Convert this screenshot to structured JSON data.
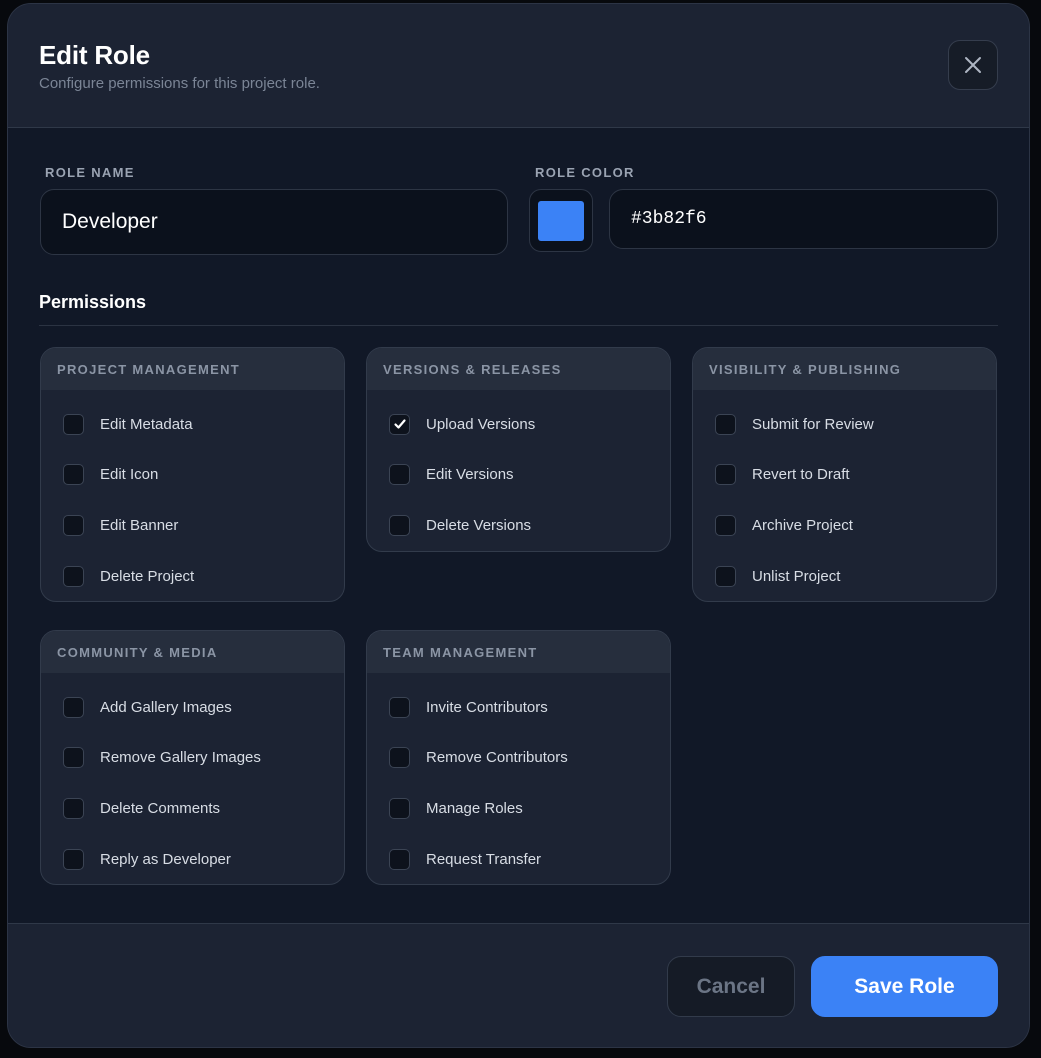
{
  "header": {
    "title": "Edit Role",
    "subtitle": "Configure permissions for this project role."
  },
  "form": {
    "role_name_label": "ROLE NAME",
    "role_name_value": "Developer",
    "role_color_label": "ROLE COLOR",
    "role_color_value": "#3b82f6",
    "swatch_color": "#3b82f6"
  },
  "permissions": {
    "title": "Permissions",
    "groups": [
      {
        "title": "PROJECT MANAGEMENT",
        "items": [
          {
            "label": "Edit Metadata",
            "checked": false
          },
          {
            "label": "Edit Icon",
            "checked": false
          },
          {
            "label": "Edit Banner",
            "checked": false
          },
          {
            "label": "Delete Project",
            "checked": false
          }
        ]
      },
      {
        "title": "VERSIONS & RELEASES",
        "items": [
          {
            "label": "Upload Versions",
            "checked": true
          },
          {
            "label": "Edit Versions",
            "checked": false
          },
          {
            "label": "Delete Versions",
            "checked": false
          }
        ]
      },
      {
        "title": "VISIBILITY & PUBLISHING",
        "items": [
          {
            "label": "Submit for Review",
            "checked": false
          },
          {
            "label": "Revert to Draft",
            "checked": false
          },
          {
            "label": "Archive Project",
            "checked": false
          },
          {
            "label": "Unlist Project",
            "checked": false
          }
        ]
      },
      {
        "title": "COMMUNITY & MEDIA",
        "items": [
          {
            "label": "Add Gallery Images",
            "checked": false
          },
          {
            "label": "Remove Gallery Images",
            "checked": false
          },
          {
            "label": "Delete Comments",
            "checked": false
          },
          {
            "label": "Reply as Developer",
            "checked": false
          }
        ]
      },
      {
        "title": "TEAM MANAGEMENT",
        "items": [
          {
            "label": "Invite Contributors",
            "checked": false
          },
          {
            "label": "Remove Contributors",
            "checked": false
          },
          {
            "label": "Manage Roles",
            "checked": false
          },
          {
            "label": "Request Transfer",
            "checked": false
          }
        ]
      }
    ]
  },
  "footer": {
    "cancel_label": "Cancel",
    "save_label": "Save Role"
  },
  "icons": {
    "close": "close-icon",
    "check": "checkmark-icon"
  },
  "colors": {
    "accent": "#3b82f6",
    "modal_bg": "#1c2333",
    "body_bg": "#111827"
  }
}
